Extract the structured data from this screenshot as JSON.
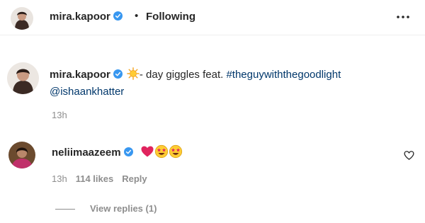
{
  "header": {
    "username": "mira.kapoor",
    "separator": "•",
    "follow_status": "Following",
    "more_icon": "more-horizontal-icon"
  },
  "caption": {
    "username": "mira.kapoor",
    "text": "- day giggles feat. ",
    "hashtag": "#theguywiththegoodlight",
    "mention": "@ishaankhatter",
    "time": "13h"
  },
  "comment": {
    "username": "neliimaazeem",
    "emojis": [
      "red-heart",
      "star-struck",
      "star-struck"
    ],
    "time": "13h",
    "likes": "114 likes",
    "reply_label": "Reply",
    "view_replies": "View replies (1)"
  },
  "colors": {
    "link": "#00376b",
    "verified": "#3897f0",
    "secondary_text": "#8e8e8e"
  }
}
